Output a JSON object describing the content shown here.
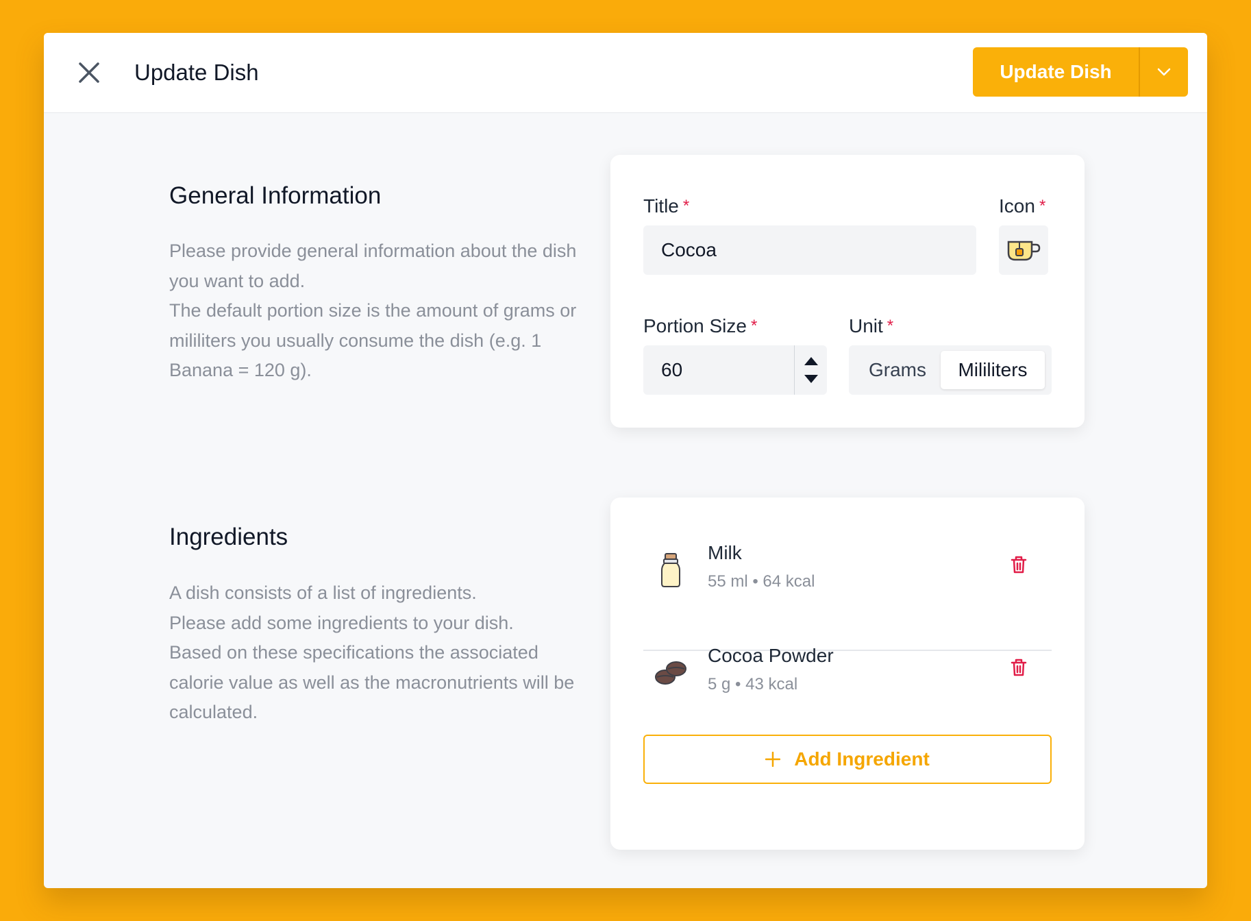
{
  "header": {
    "title": "Update Dish",
    "primary_action": "Update Dish"
  },
  "general": {
    "heading": "General Information",
    "description": "Please provide general information about the dish you want to add.\nThe default portion size is the amount of grams or mililiters you usually consume the dish (e.g. 1 Banana = 120 g).",
    "title_label": "Title",
    "title_value": "Cocoa",
    "icon_label": "Icon",
    "icon_name": "teacup-icon",
    "portion_label": "Portion Size",
    "portion_value": "60",
    "unit_label": "Unit",
    "unit_options": [
      "Grams",
      "Mililiters"
    ],
    "unit_selected": "Mililiters",
    "required_mark": "*"
  },
  "ingredients": {
    "heading": "Ingredients",
    "description": "A dish consists of a list of ingredients.\nPlease add some ingredients to your dish.\nBased on these specifications the associated calorie value as well as the macronutrients will be calculated.",
    "items": [
      {
        "name": "Milk",
        "meta": "55 ml • 64 kcal",
        "icon": "milk-bottle-icon"
      },
      {
        "name": "Cocoa Powder",
        "meta": "5 g • 43 kcal",
        "icon": "coffee-beans-icon"
      }
    ],
    "add_label": "Add Ingredient"
  },
  "colors": {
    "background": "#FAAB0A",
    "accent": "#FAB009",
    "danger": "#E11D48"
  }
}
